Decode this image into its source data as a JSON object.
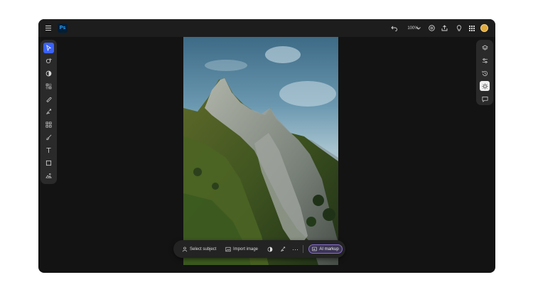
{
  "app": {
    "logo_text": "Ps",
    "zoom_label": "100%",
    "brand_color": "#31a8ff",
    "accent_color": "#3b63fb"
  },
  "topbar": {
    "icons": [
      "menu-icon",
      "undo-icon",
      "chevron-down-icon",
      "share-link-icon",
      "upload-icon",
      "lightbulb-icon",
      "apps-grid-icon",
      "avatar"
    ]
  },
  "left_toolbar": {
    "tools": [
      "select-tool",
      "quick-action-tool",
      "adjustment-tool",
      "selection-tool",
      "retouch-tool",
      "generative-fill-tool",
      "crop-tool",
      "brush-tool",
      "text-tool",
      "shape-tool",
      "add-image-tool"
    ],
    "active_tool": "select-tool"
  },
  "right_panel": {
    "items": [
      "layers",
      "properties",
      "history",
      "effects",
      "comments"
    ],
    "active_item": "effects"
  },
  "taskbar": {
    "select_subject": "Select subject",
    "import_image": "Import image",
    "ai_markup": "AI markup"
  }
}
